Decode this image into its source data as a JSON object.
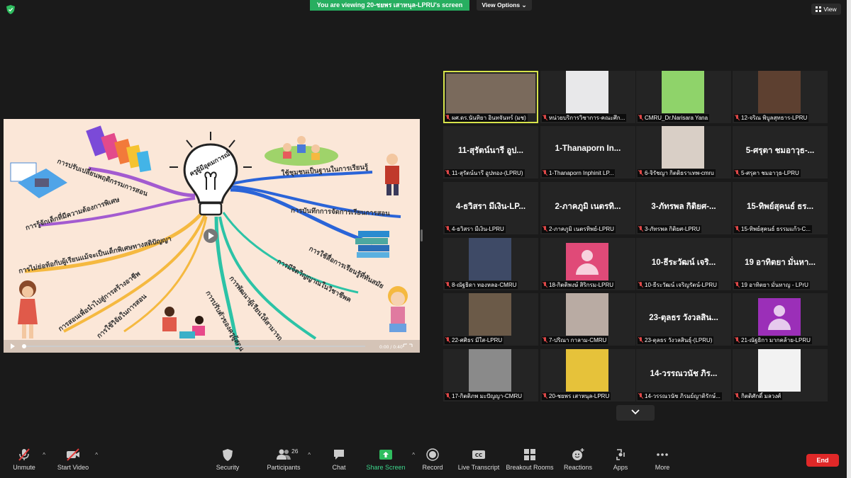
{
  "top_bar": {
    "viewing_banner": "You are viewing 20-ชยพร เสาหนุล-LPRU's screen",
    "view_options": "View Options",
    "view_button": "View"
  },
  "share": {
    "title": "ครูผู้มีอุดมการณ์",
    "branches": [
      "การปรับเปลี่ยนพฤติกรรมการสอน",
      "การรู้จักเด็กที่มีความต้องการพิเศษ",
      "การไม่ย่อท้อกับผู้เรียนแม้จะเป็นเด็กพิเศษทางสติปัญญา",
      "การสอนเพื่อนำไปสู่การสร้างอาชีพ",
      "การใช้วิจัยในการสอน",
      "การปรับตัวของครูผู้สอน",
      "การพัฒนาผู้เรียนให้สามารถคิดและลงมือปฏิบัติได้",
      "การมีจิตวิญญาณในวิชาชีพครู",
      "การใช้สื่อการเรียนรู้ที่ทันสมัย",
      "การบันทึกการจัดการเรียนการสอน",
      "ใช้ชุมชนเป็นฐานในการเรียนรู้"
    ],
    "time_display": "0:00 / 0:40"
  },
  "gallery": {
    "tiles": [
      {
        "big": "",
        "label": "ผศ.ดร.นันทิยา อินทจันทร์ (มช)",
        "photo": "#7a6a5c",
        "active": true
      },
      {
        "big": "",
        "label": "หน่วยบริการวิชาการ-คณะศึก...",
        "photo": "#e8e8ea",
        "active": false
      },
      {
        "big": "",
        "label": "CMRU_Dr.Narisara Yana",
        "photo": "#8fd36a",
        "active": false
      },
      {
        "big": "",
        "label": "12-จริณ พิบูลสุทธาร-LPRU",
        "photo": "#5d4030",
        "active": false
      },
      {
        "big": "11-สุรัตน์นารี อูป...",
        "label": "11-สุรัตน์นารี อูปทอง-(LPRU)",
        "photo": "",
        "active": false
      },
      {
        "big": "1-Thanaporn  In...",
        "label": "1-Thanaporn Inphinit LP...",
        "photo": "",
        "active": false
      },
      {
        "big": "",
        "label": "6-จิรัชญา กิตติธราเทพ-cmru",
        "photo": "#d9cfc6",
        "active": false
      },
      {
        "big": "5-ศรุตา ชมอาวุธ-...",
        "label": "5-ศรุตา ชมอาวุธ-LPRU",
        "photo": "",
        "active": false
      },
      {
        "big": "4-ธวิสรา มีเงิน-LP...",
        "label": "4-ธวิสรา มีเงิน-LPRU",
        "photo": "",
        "active": false
      },
      {
        "big": "2-ภาคภูมิ เนตรทิ...",
        "label": "2-ภาคภูมิ เนตรทิพย์-LPRU",
        "photo": "",
        "active": false
      },
      {
        "big": "3-ภัทรพล กิติยศ-...",
        "label": "3-ภัทรพล กิติยศ-LPRU",
        "photo": "",
        "active": false
      },
      {
        "big": "15-ทิพย์สุคนธ์ ธร...",
        "label": "15-ทิพย์สุคนธ์ ธรรมแก้ว-C...",
        "photo": "",
        "active": false
      },
      {
        "big": "",
        "label": "8-ณัฐธิดา ทองหลอ-CMRU",
        "photo": "#3e4a66",
        "active": false
      },
      {
        "big": "",
        "label": "18-กิตติพงษ์ สิริกรม-LPRU",
        "photo": "avatar:#e04a78",
        "active": false
      },
      {
        "big": "10-ธีระวัฒน์ เจริ...",
        "label": "10-ธีระวัฒน์ เจริญรัตน์-LPRU",
        "photo": "",
        "active": false
      },
      {
        "big": "19 อาทิตยา มั่นหา...",
        "label": "19 อาทิตยา มั่นหาญ - LPrU",
        "photo": "",
        "active": false
      },
      {
        "big": "",
        "label": "22-ศศิธร มีใส-LPRU",
        "photo": "#6b5a48",
        "active": false
      },
      {
        "big": "",
        "label": "7-ปริณา กาลาม-CMRU",
        "photo": "#b9aba3",
        "active": false
      },
      {
        "big": "23-ตุลธร วังวลสิน...",
        "label": "23-ตุลธร วังวลสินธุ์-(LPRU)",
        "photo": "",
        "active": false
      },
      {
        "big": "",
        "label": "21-ณัฐธิกา มากคล้าย-LPRU",
        "photo": "avatar:#9b2fb8",
        "active": false
      },
      {
        "big": "",
        "label": "17-กิตติภพ มะปัญญา-CMRU",
        "photo": "#8a8a8a",
        "active": false
      },
      {
        "big": "",
        "label": "20-ชยพร เสาหนุล-LPRU",
        "photo": "#e6c23a",
        "active": false
      },
      {
        "big": "14-วรรณวนัช ภิร...",
        "label": "14-วรรณวนัช ภิรมย์ญาติรักษ์...",
        "photo": "",
        "active": false
      },
      {
        "big": "",
        "label": "กิตติศักดิ์ มลวงศ์",
        "photo": "#f2f2f2",
        "active": false
      }
    ]
  },
  "toolbar": {
    "unmute": "Unmute",
    "start_video": "Start Video",
    "security": "Security",
    "participants": "Participants",
    "participants_count": "26",
    "chat": "Chat",
    "share_screen": "Share Screen",
    "record": "Record",
    "live_transcript": "Live Transcript",
    "breakout_rooms": "Breakout Rooms",
    "reactions": "Reactions",
    "apps": "Apps",
    "more": "More",
    "end": "End"
  }
}
